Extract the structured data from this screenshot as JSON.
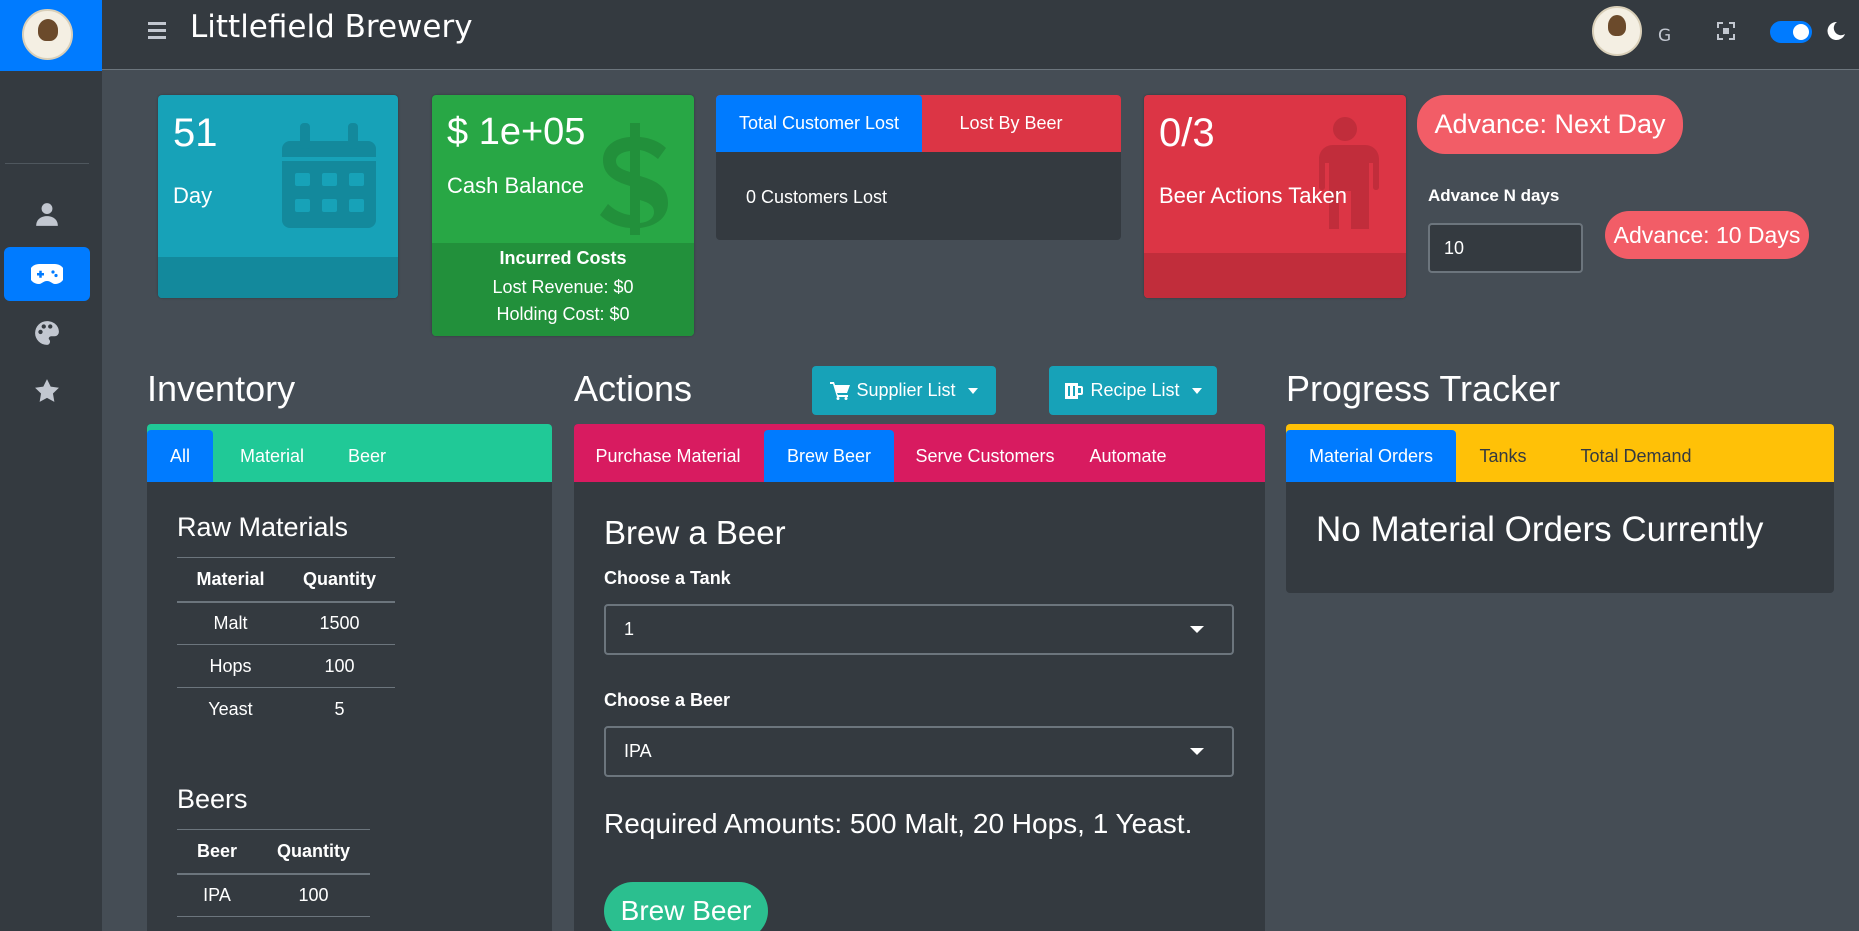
{
  "app": {
    "title": "Littlefield Brewery",
    "user_initial": "G"
  },
  "sidebar": {
    "items": [
      {
        "icon": "user-icon",
        "active": false
      },
      {
        "icon": "gamepad-icon",
        "active": true
      },
      {
        "icon": "palette-icon",
        "active": false
      },
      {
        "icon": "star-icon",
        "active": false
      }
    ]
  },
  "stats": {
    "day": {
      "value": "51",
      "label": "Day"
    },
    "cash": {
      "value": "$ 1e+05",
      "label": "Cash Balance",
      "costs_title": "Incurred Costs",
      "lost_revenue": "Lost Revenue: $0",
      "holding_cost": "Holding Cost: $0"
    },
    "customers": {
      "tabs": [
        "Total Customer Lost",
        "Lost By Beer"
      ],
      "body": "0 Customers Lost"
    },
    "beer_actions": {
      "value": "0/3",
      "label": "Beer Actions Taken"
    }
  },
  "advance": {
    "next_day_label": "Advance: Next Day",
    "n_days_label": "Advance N days",
    "n_days_value": "10",
    "ten_days_label": "Advance: 10 Days"
  },
  "inventory": {
    "title": "Inventory",
    "tabs": [
      "All",
      "Material",
      "Beer"
    ],
    "raw_title": "Raw Materials",
    "raw_headers": [
      "Material",
      "Quantity"
    ],
    "raw_rows": [
      [
        "Malt",
        "1500"
      ],
      [
        "Hops",
        "100"
      ],
      [
        "Yeast",
        "5"
      ]
    ],
    "beers_title": "Beers",
    "beer_headers": [
      "Beer",
      "Quantity"
    ],
    "beer_rows": [
      [
        "IPA",
        "100"
      ]
    ]
  },
  "actions": {
    "title": "Actions",
    "supplier_btn": "Supplier List",
    "recipe_btn": "Recipe List",
    "tabs": [
      "Purchase Material",
      "Brew Beer",
      "Serve Customers",
      "Automate"
    ],
    "brew_title": "Brew a Beer",
    "tank_label": "Choose a Tank",
    "tank_value": "1",
    "beer_label": "Choose a Beer",
    "beer_value": "IPA",
    "required": "Required Amounts: 500 Malt, 20 Hops, 1 Yeast.",
    "brew_btn": "Brew Beer"
  },
  "progress": {
    "title": "Progress Tracker",
    "tabs": [
      "Material Orders",
      "Tanks",
      "Total Demand"
    ],
    "body": "No Material Orders Currently"
  },
  "colors": {
    "primary": "#007bff",
    "info": "#17a2b8",
    "success": "#28a745",
    "danger": "#dc3545",
    "teal": "#20c997",
    "pink": "#d81b60",
    "warning": "#ffc107"
  }
}
